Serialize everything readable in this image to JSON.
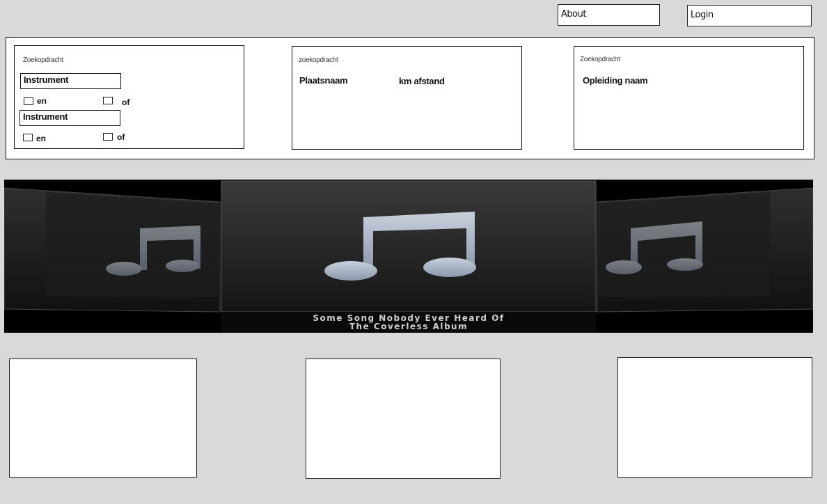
{
  "header": {
    "about_label": "About",
    "login_label": "Login"
  },
  "search": {
    "instrument": {
      "heading": "Zoekopdracht",
      "field1": "Instrument",
      "field2": "Instrument",
      "en_label": "en",
      "of_label": "of"
    },
    "location": {
      "heading": "zoekopdracht",
      "place_label": "Plaatsnaam",
      "distance_label": "km afstand"
    },
    "education": {
      "heading": "Zoekopdracht",
      "name_label": "Opleiding naam"
    }
  },
  "banner": {
    "song_title": "Some Song Nobody Ever Heard Of",
    "album_title": "The Coverless Album",
    "icon": "music-note-icon"
  }
}
